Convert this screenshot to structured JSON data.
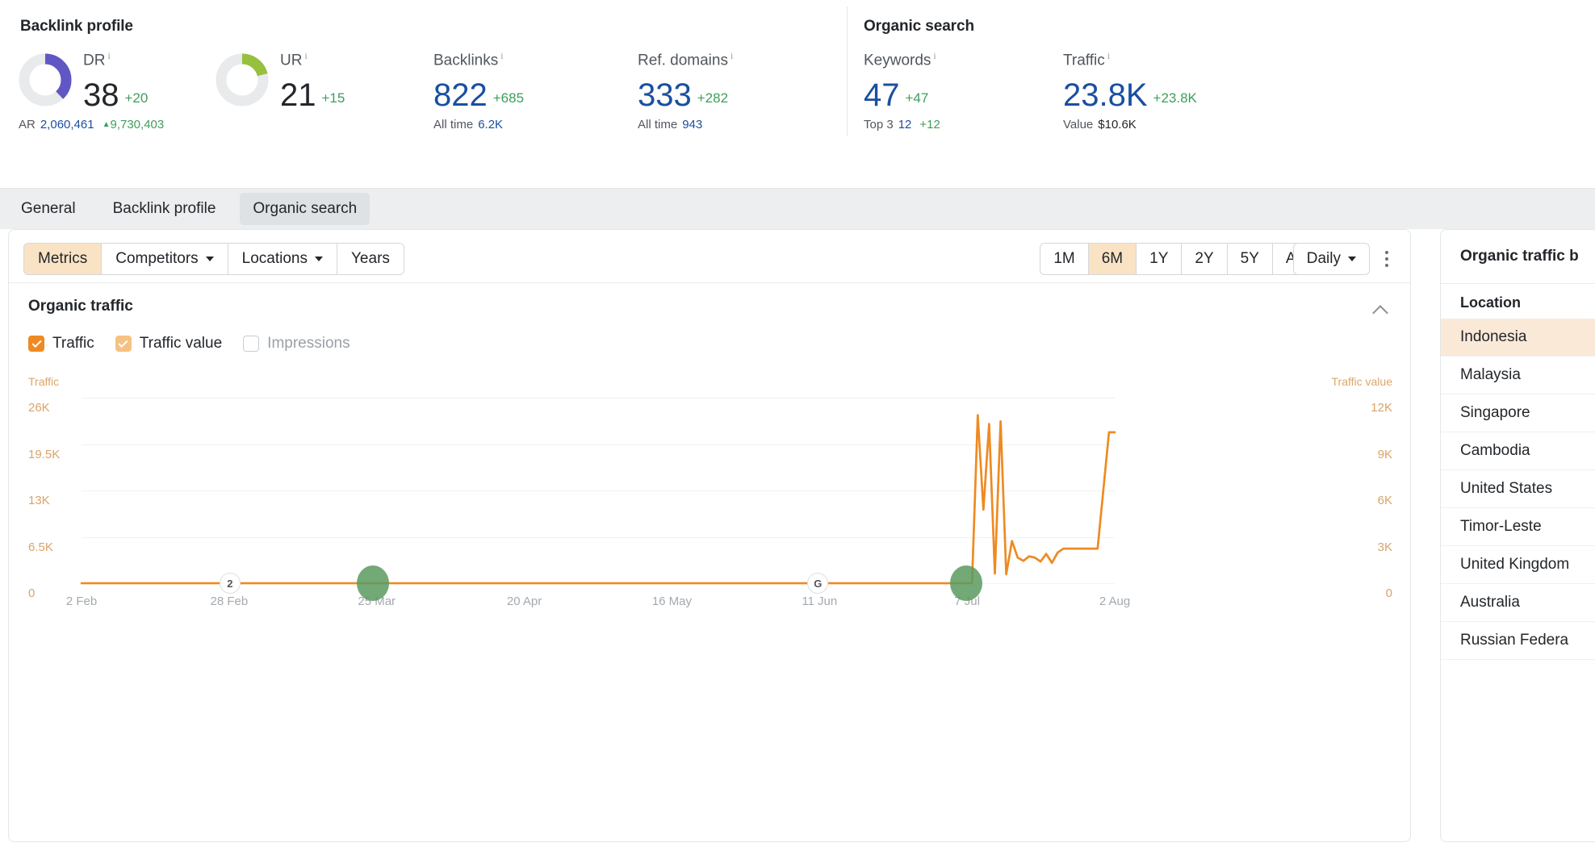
{
  "backlink_panel": {
    "title": "Backlink profile",
    "metrics": [
      {
        "label": "DR",
        "info": "i",
        "value": "38",
        "delta": "+20",
        "value_color": "#23262a",
        "donut": {
          "percent": 38,
          "color": "#6157c4"
        },
        "sub": {
          "label": "AR",
          "value": "2,060,461",
          "growth": "9,730,403",
          "growth_prefix": "▲"
        }
      },
      {
        "label": "UR",
        "info": "i",
        "value": "21",
        "delta": "+15",
        "value_color": "#23262a",
        "donut": {
          "percent": 21,
          "color": "#96c03d"
        },
        "sub": null
      },
      {
        "label": "Backlinks",
        "info": "i",
        "value": "822",
        "delta": "+685",
        "value_color": "#1a4fa0",
        "donut": null,
        "sub": {
          "label": "All time",
          "value": "6.2K"
        }
      },
      {
        "label": "Ref. domains",
        "info": "i",
        "value": "333",
        "delta": "+282",
        "value_color": "#1a4fa0",
        "donut": null,
        "sub": {
          "label": "All time",
          "value": "943"
        }
      }
    ]
  },
  "organic_panel": {
    "title": "Organic search",
    "metrics": [
      {
        "label": "Keywords",
        "info": "i",
        "value": "47",
        "delta": "+47",
        "value_color": "#1a4fa0",
        "sub": {
          "label": "Top 3",
          "value": "12",
          "growth": "+12"
        }
      },
      {
        "label": "Traffic",
        "info": "i",
        "value": "23.8K",
        "delta": "+23.8K",
        "value_color": "#1a4fa0",
        "sub": {
          "label": "Value",
          "value": "$10.6K"
        }
      }
    ]
  },
  "tabs": [
    {
      "label": "General",
      "active": false
    },
    {
      "label": "Backlink profile",
      "active": false
    },
    {
      "label": "Organic search",
      "active": true
    }
  ],
  "toolbar": {
    "left_buttons": [
      {
        "label": "Metrics",
        "active": true,
        "caret": false
      },
      {
        "label": "Competitors",
        "active": false,
        "caret": true
      },
      {
        "label": "Locations",
        "active": false,
        "caret": true
      },
      {
        "label": "Years",
        "active": false,
        "caret": false
      }
    ],
    "ranges": [
      {
        "label": "1M",
        "active": false
      },
      {
        "label": "6M",
        "active": true
      },
      {
        "label": "1Y",
        "active": false
      },
      {
        "label": "2Y",
        "active": false
      },
      {
        "label": "5Y",
        "active": false
      },
      {
        "label": "All",
        "active": false
      }
    ],
    "granularity": "Daily",
    "more_menu": "kebab-menu"
  },
  "chart_section": {
    "title": "Organic traffic",
    "collapse_icon": "chevron-up-icon",
    "legend": [
      {
        "label": "Traffic",
        "checked": true,
        "style": "dark",
        "color": "#ef8a22"
      },
      {
        "label": "Traffic value",
        "checked": true,
        "style": "light",
        "color": "#f6c183"
      },
      {
        "label": "Impressions",
        "checked": false,
        "style": "off",
        "color": "#9aa0a6"
      }
    ]
  },
  "chart_data": {
    "type": "line",
    "title": "Organic traffic",
    "xlabel": "",
    "ylabel": "Traffic",
    "y2label": "Traffic value",
    "left_axis_caption": "Traffic",
    "right_axis_caption": "Traffic value",
    "left_ticks": [
      "26K",
      "19.5K",
      "13K",
      "6.5K",
      "0"
    ],
    "left_tick_values": [
      26000,
      19500,
      13000,
      6500,
      0
    ],
    "right_ticks": [
      "12K",
      "9K",
      "6K",
      "3K",
      "0"
    ],
    "right_tick_values": [
      12000,
      9000,
      6000,
      3000,
      0
    ],
    "ylim": [
      0,
      29000
    ],
    "y2lim": [
      0,
      13400
    ],
    "x_ticks": [
      "2 Feb",
      "28 Feb",
      "25 Mar",
      "20 Apr",
      "16 May",
      "11 Jun",
      "7 Jul",
      "2 Aug"
    ],
    "grid": true,
    "legend_position": "top-left",
    "series": [
      {
        "name": "Traffic",
        "color": "#ef8a22",
        "x": [
          "2 Feb",
          "28 Feb",
          "25 Mar",
          "20 Apr",
          "16 May",
          "11 Jun",
          "1 Jul",
          "8 Jul",
          "9 Jul",
          "10 Jul",
          "11 Jul",
          "12 Jul",
          "13 Jul",
          "14 Jul",
          "15 Jul",
          "16 Jul",
          "17 Jul",
          "18 Jul",
          "19 Jul",
          "20 Jul",
          "21 Jul",
          "22 Jul",
          "23 Jul",
          "24 Jul",
          "26 Jul",
          "28 Jul",
          "30 Jul",
          "1 Aug",
          "2 Aug"
        ],
        "values": [
          0,
          0,
          0,
          0,
          0,
          0,
          0,
          0,
          26300,
          11500,
          24900,
          1500,
          25300,
          1400,
          6600,
          4000,
          3500,
          4200,
          4000,
          3400,
          4600,
          3200,
          4800,
          5400,
          5400,
          5400,
          5400,
          23600,
          23600
        ]
      },
      {
        "name": "Traffic value",
        "color": "#f6c183",
        "x": [
          "2 Feb",
          "28 Feb",
          "25 Mar",
          "20 Apr",
          "16 May",
          "11 Jun",
          "1 Jul",
          "8 Jul",
          "9 Jul",
          "10 Jul",
          "11 Jul",
          "12 Jul",
          "13 Jul",
          "14 Jul",
          "15 Jul",
          "16 Jul",
          "17 Jul",
          "18 Jul",
          "19 Jul",
          "20 Jul",
          "21 Jul",
          "22 Jul",
          "23 Jul",
          "24 Jul",
          "26 Jul",
          "28 Jul",
          "30 Jul",
          "1 Aug",
          "2 Aug"
        ],
        "values": [
          0,
          0,
          0,
          0,
          0,
          0,
          0,
          0,
          12100,
          5300,
          11500,
          700,
          11700,
          650,
          3050,
          1850,
          1600,
          1950,
          1850,
          1550,
          2100,
          1450,
          2200,
          2500,
          2500,
          2500,
          2500,
          10900,
          10900
        ]
      }
    ],
    "annotations": [
      {
        "type": "badge",
        "label": "2",
        "x_position": "28 Feb",
        "name": "event-badge-2"
      },
      {
        "type": "badge",
        "label": "G",
        "x_position": "11 Jun",
        "name": "google-update-badge"
      },
      {
        "type": "dot",
        "x_position": "25 Mar",
        "color": "#5b9a5f",
        "name": "serp-feature-dot"
      },
      {
        "type": "dot",
        "x_position": "7 Jul",
        "color": "#5b9a5f",
        "name": "serp-feature-dot"
      }
    ]
  },
  "right_panel": {
    "title": "Organic traffic b",
    "column_header": "Location",
    "rows": [
      {
        "label": "Indonesia",
        "selected": true
      },
      {
        "label": "Malaysia",
        "selected": false
      },
      {
        "label": "Singapore",
        "selected": false
      },
      {
        "label": "Cambodia",
        "selected": false
      },
      {
        "label": "United States",
        "selected": false
      },
      {
        "label": "Timor-Leste",
        "selected": false
      },
      {
        "label": "United Kingdom",
        "selected": false
      },
      {
        "label": "Australia",
        "selected": false
      },
      {
        "label": "Russian Federa",
        "selected": false
      }
    ]
  }
}
